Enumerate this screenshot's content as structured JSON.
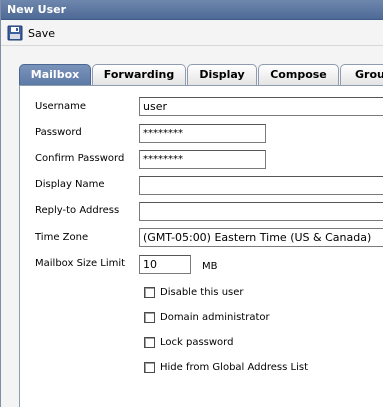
{
  "window": {
    "title": "New User"
  },
  "toolbar": {
    "save_label": "Save",
    "save_icon": "floppy-disk-icon"
  },
  "tabs": [
    {
      "label": "Mailbox",
      "active": true
    },
    {
      "label": "Forwarding",
      "active": false
    },
    {
      "label": "Display",
      "active": false
    },
    {
      "label": "Compose",
      "active": false
    },
    {
      "label": "Group",
      "active": false
    }
  ],
  "form": {
    "username": {
      "label": "Username",
      "value": "user"
    },
    "password": {
      "label": "Password",
      "value": "********"
    },
    "confirm_password": {
      "label": "Confirm Password",
      "value": "********"
    },
    "display_name": {
      "label": "Display Name",
      "value": ""
    },
    "reply_to": {
      "label": "Reply-to Address",
      "value": ""
    },
    "time_zone": {
      "label": "Time Zone",
      "value": "(GMT-05:00) Eastern Time (US & Canada)"
    },
    "mailbox_size": {
      "label": "Mailbox Size Limit",
      "value": "10",
      "unit": "MB"
    },
    "checkboxes": [
      {
        "label": "Disable this user",
        "checked": false
      },
      {
        "label": "Domain administrator",
        "checked": false
      },
      {
        "label": "Lock password",
        "checked": false
      },
      {
        "label": "Hide from Global Address List",
        "checked": false
      }
    ]
  },
  "colors": {
    "titlebar": "#5a76a1",
    "active_tab": "#6985b0",
    "panel_bg": "#ffffff"
  }
}
